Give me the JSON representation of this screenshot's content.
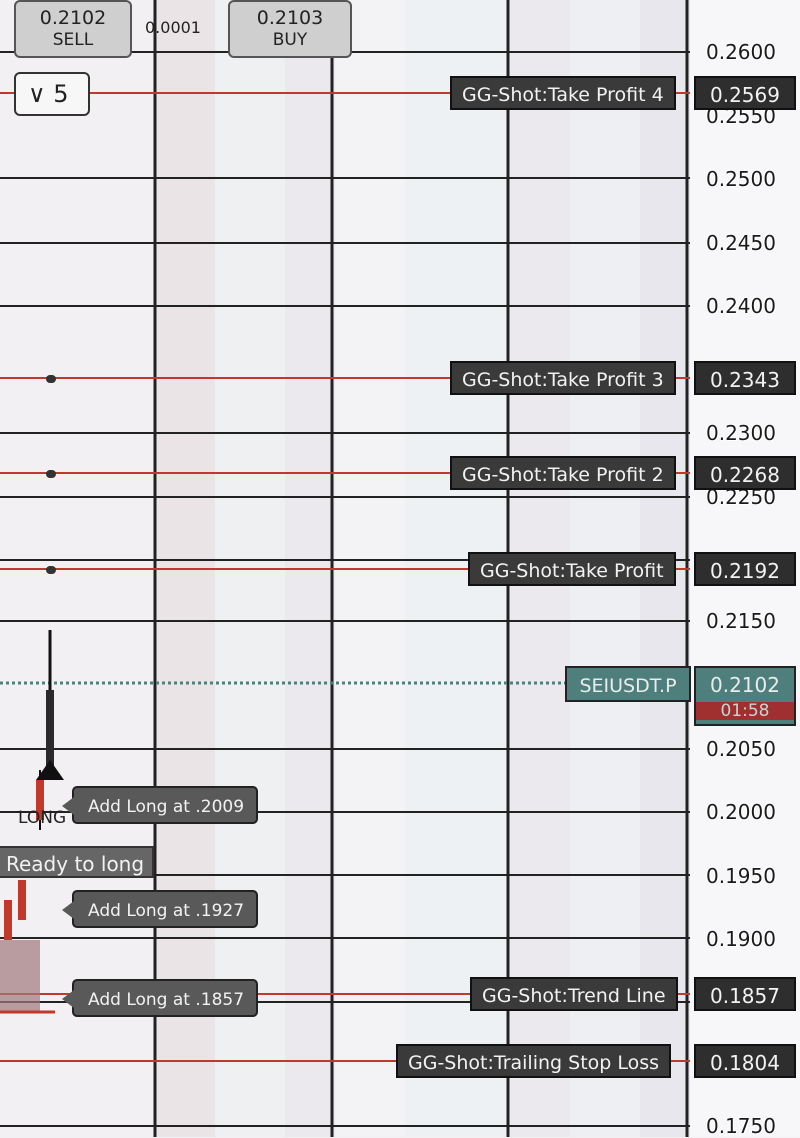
{
  "trade_panel": {
    "sell": {
      "price": "0.2102",
      "label": "SELL"
    },
    "buy": {
      "price": "0.2103",
      "label": "BUY"
    },
    "spread": "0.0001",
    "collapse": {
      "icon": "chevron-double-down-icon",
      "count": "5"
    }
  },
  "price_axis": {
    "ticks": [
      "0.2600",
      "0.2550",
      "0.2500",
      "0.2450",
      "0.2400",
      "0.2300",
      "0.2250",
      "0.2150",
      "0.2050",
      "0.2000",
      "0.1950",
      "0.1900",
      "0.1750"
    ]
  },
  "levels": {
    "tp4": {
      "label": "GG-Shot:Take Profit 4",
      "value": "0.2569"
    },
    "tp3": {
      "label": "GG-Shot:Take Profit 3",
      "value": "0.2343"
    },
    "tp2": {
      "label": "GG-Shot:Take Profit 2",
      "value": "0.2268"
    },
    "tp1": {
      "label": "GG-Shot:Take Profit",
      "value": "0.2192"
    },
    "trend": {
      "label": "GG-Shot:Trend Line",
      "value": "0.1857"
    },
    "trailing": {
      "label": "GG-Shot:Trailing Stop Loss",
      "value": "0.1804"
    }
  },
  "symbol": {
    "label": "SEIUSDT.P",
    "value": "0.2102",
    "countdown": "01:58",
    "color": "#4f7f7c"
  },
  "orders": {
    "add1": "Add Long at .2009",
    "add2": "Add Long at .1927",
    "add3": "Add Long at .1857"
  },
  "signals": {
    "long": "LONG",
    "status": "Ready to long"
  },
  "colors": {
    "level_line": "#c0392b",
    "grid": "#222222",
    "candle_up": "#2a2a2a",
    "candle_down": "#c0392b"
  }
}
